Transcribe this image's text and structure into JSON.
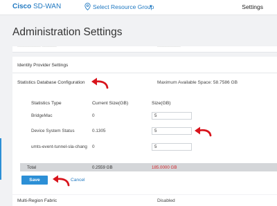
{
  "header": {
    "brand_bold": "Cisco",
    "brand_rest": " SD-WAN",
    "resource_group": "Select Resource Group",
    "resource_caret": "▾",
    "settings": "Settings"
  },
  "page": {
    "title": "Administration Settings"
  },
  "sections": {
    "identity_provider": "Identity Provider Settings",
    "stats_db": {
      "title": "Statistics Database Configuration",
      "max_space": "Maximum Available Space: 58.7586 GB",
      "headers": {
        "type": "Statistics Type",
        "current": "Current Size(GB)",
        "size": "Size(GB)"
      },
      "rows": [
        {
          "type": "BridgeMac",
          "current": "0",
          "size": "5"
        },
        {
          "type": "Device System Status",
          "current": "0.1305",
          "size": "5"
        },
        {
          "type": "umts-event-tunnel-sla-chang",
          "current": "0",
          "size": "5"
        }
      ],
      "total": {
        "label": "Total",
        "current": "0.2559 GB",
        "size": "185.0000 GB"
      },
      "save": "Save",
      "cancel": "Cancel"
    },
    "multi_region": {
      "label": "Multi-Region Fabric",
      "value": "Disabled"
    }
  },
  "colors": {
    "accent": "#2c8fd6",
    "link": "#1f78c1",
    "total_red": "#d1252b",
    "annotation_arrow": "#d8141c"
  },
  "icons": [
    "location-pin-icon",
    "dropdown-caret-icon",
    "annotation-arrow-icon"
  ]
}
